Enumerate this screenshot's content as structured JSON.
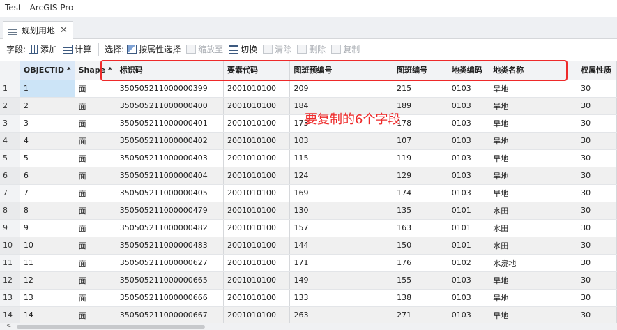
{
  "window": {
    "title": "Test - ArcGIS Pro"
  },
  "tab": {
    "label": "规划用地",
    "close": "✕"
  },
  "toolbar": {
    "field_label": "字段:",
    "add_label": "添加",
    "calc_label": "计算",
    "select_label": "选择:",
    "by_attr_label": "按属性选择",
    "zoom_label": "缩放至",
    "switch_label": "切换",
    "clear_label": "清除",
    "delete_label": "删除",
    "copy_label": "复制"
  },
  "table": {
    "columns": [
      "OBJECTID *",
      "Shape *",
      "标识码",
      "要素代码",
      "图斑预编号",
      "图斑编号",
      "地类编码",
      "地类名称",
      "权属性质"
    ],
    "rows": [
      [
        "1",
        "1",
        "面",
        "350505211000000399",
        "2001010100",
        "209",
        "215",
        "0103",
        "旱地",
        "30"
      ],
      [
        "2",
        "2",
        "面",
        "350505211000000400",
        "2001010100",
        "184",
        "189",
        "0103",
        "旱地",
        "30"
      ],
      [
        "3",
        "3",
        "面",
        "350505211000000401",
        "2001010100",
        "173",
        "178",
        "0103",
        "旱地",
        "30"
      ],
      [
        "4",
        "4",
        "面",
        "350505211000000402",
        "2001010100",
        "103",
        "107",
        "0103",
        "旱地",
        "30"
      ],
      [
        "5",
        "5",
        "面",
        "350505211000000403",
        "2001010100",
        "115",
        "119",
        "0103",
        "旱地",
        "30"
      ],
      [
        "6",
        "6",
        "面",
        "350505211000000404",
        "2001010100",
        "124",
        "129",
        "0103",
        "旱地",
        "30"
      ],
      [
        "7",
        "7",
        "面",
        "350505211000000405",
        "2001010100",
        "169",
        "174",
        "0103",
        "旱地",
        "30"
      ],
      [
        "8",
        "8",
        "面",
        "350505211000000479",
        "2001010100",
        "130",
        "135",
        "0101",
        "水田",
        "30"
      ],
      [
        "9",
        "9",
        "面",
        "350505211000000482",
        "2001010100",
        "157",
        "163",
        "0101",
        "水田",
        "30"
      ],
      [
        "10",
        "10",
        "面",
        "350505211000000483",
        "2001010100",
        "144",
        "150",
        "0101",
        "水田",
        "30"
      ],
      [
        "11",
        "11",
        "面",
        "350505211000000627",
        "2001010100",
        "171",
        "176",
        "0102",
        "水浇地",
        "30"
      ],
      [
        "12",
        "12",
        "面",
        "350505211000000665",
        "2001010100",
        "149",
        "155",
        "0103",
        "旱地",
        "30"
      ],
      [
        "13",
        "13",
        "面",
        "350505211000000666",
        "2001010100",
        "133",
        "138",
        "0103",
        "旱地",
        "30"
      ],
      [
        "14",
        "14",
        "面",
        "350505211000000667",
        "2001010100",
        "263",
        "271",
        "0103",
        "旱地",
        "30"
      ]
    ]
  },
  "annotation": {
    "text": "要复制的6个字段",
    "color": "#ee2a2a"
  },
  "colors": {
    "selected_cell": "#cce4f7",
    "header_pk": "#dbe8f7",
    "alt_row": "#f0f0f0"
  },
  "icons": [
    "table-icon",
    "add-field-icon",
    "calculate-icon",
    "select-by-attribute-icon",
    "zoom-to-icon",
    "switch-icon",
    "clear-icon",
    "delete-icon",
    "copy-icon",
    "scroll-left-icon"
  ]
}
